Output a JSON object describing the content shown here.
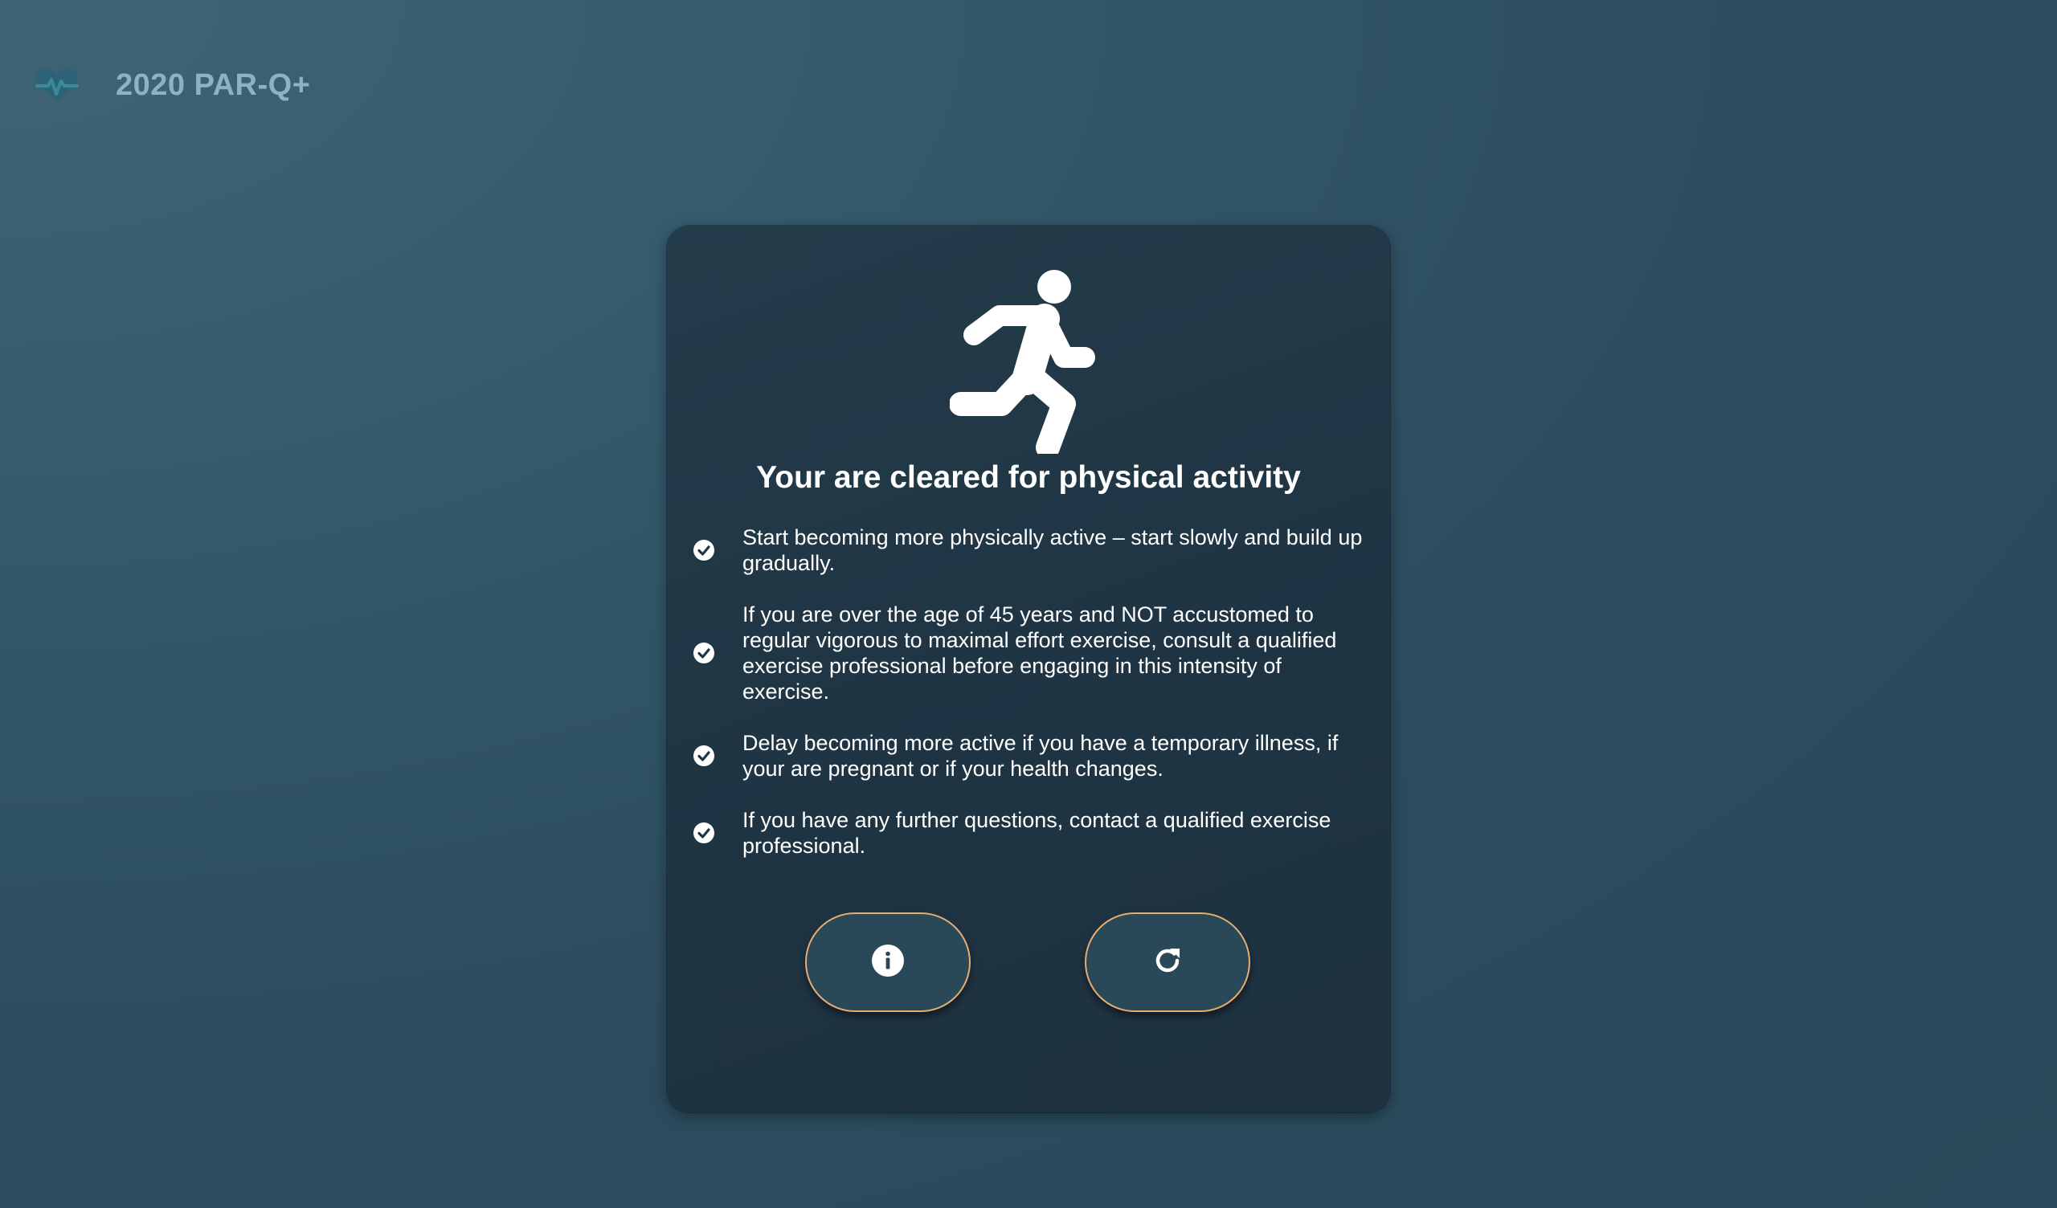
{
  "header": {
    "title": "2020 PAR-Q+",
    "icon": "heart-pulse-icon"
  },
  "result": {
    "icon": "running-person-icon",
    "title": "Your are cleared for physical activity",
    "items": [
      {
        "icon": "check-circle-icon",
        "text": "Start becoming more physically active – start slowly and build up gradually."
      },
      {
        "icon": "check-circle-icon",
        "text": "If you are over the age of 45 years and NOT accustomed to regular vigorous to maximal effort exercise, consult a qualified exercise professional before engaging in this intensity of exercise."
      },
      {
        "icon": "check-circle-icon",
        "text": "Delay becoming more active if you have a temporary illness, if your are pregnant or if your health changes."
      },
      {
        "icon": "check-circle-icon",
        "text": "If you have any further questions, contact a qualified exercise professional."
      }
    ]
  },
  "actions": {
    "info_icon": "info-icon",
    "restart_icon": "restart-icon"
  },
  "colors": {
    "background": "#2f5467",
    "card": "#203545",
    "button_border": "#e8ac6f",
    "button_fill": "#294858",
    "header_text": "#8eb1c4"
  }
}
